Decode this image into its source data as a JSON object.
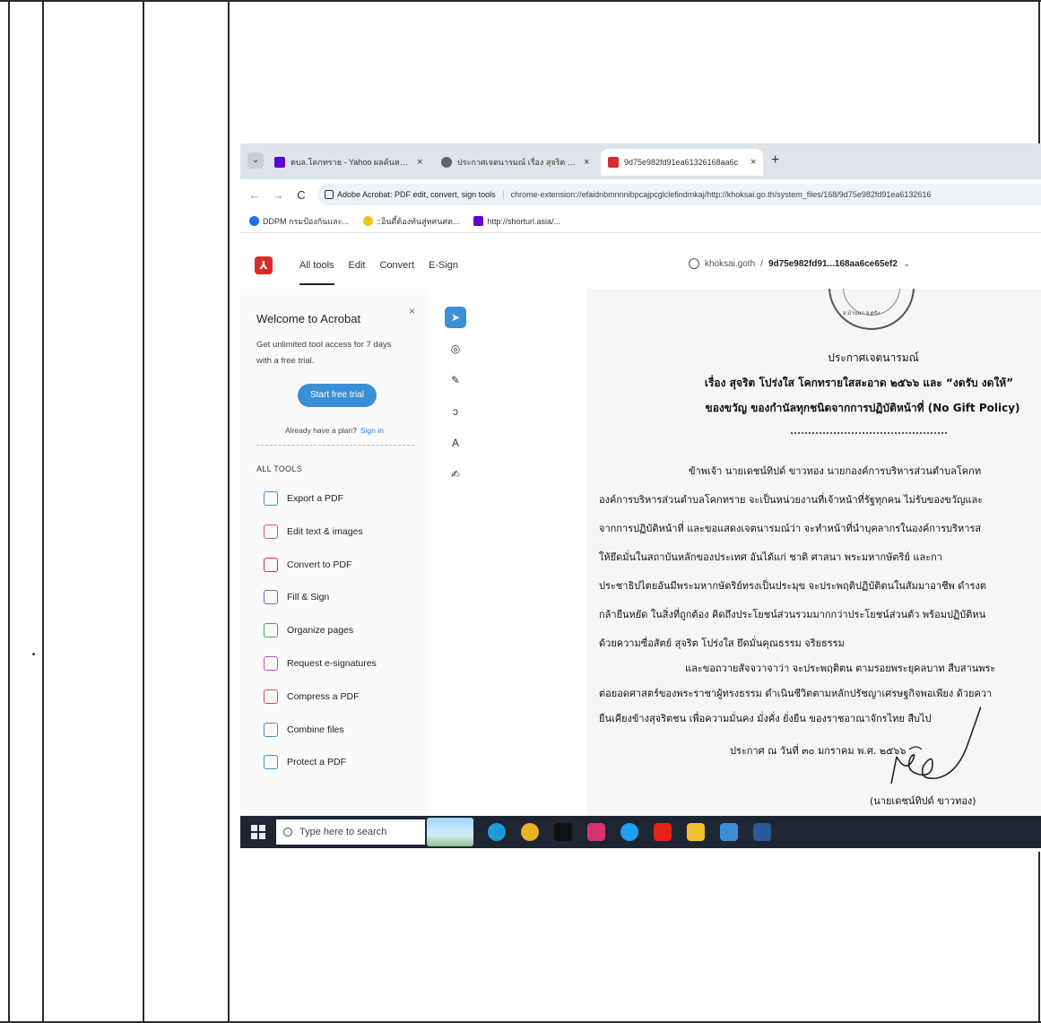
{
  "browser": {
    "tabs": [
      {
        "title": "ตบล.โคกทราย - Yahoo ผลค้นหาภา",
        "favicon_color": "#5f01d1",
        "active": false
      },
      {
        "title": "ประกาศเจตนารมณ์ เรื่อง สุจริต โปร่",
        "favicon_color": "#5f6368",
        "active": false
      },
      {
        "title": "9d75e982fd91ea61326168aa6c",
        "favicon_color": "#d92b2b",
        "active": true
      }
    ],
    "close_glyph": "×",
    "new_tab_glyph": "+",
    "tab_menu_glyph": "⌄",
    "nav": {
      "back": "←",
      "forward": "→",
      "reload": "C"
    },
    "site_label": "Adobe Acrobat: PDF edit, convert, sign tools",
    "url": "chrome-extension://efaidnbmnnnibpcajpcglclefindmkaj/http://khoksai.go.th/system_files/168/9d75e982fd91ea6132616",
    "bookmarks": [
      {
        "label": "DDPM กรมป้องกันและ...",
        "color": "#1a73e8"
      },
      {
        "label": "::อินดี้ต้องทันสู่ทศนศต...",
        "color": "#f0c419"
      },
      {
        "label": "http://shorturl.asia/...",
        "color": "#5f01d1"
      }
    ]
  },
  "acrobat": {
    "logo_glyph": "⅄",
    "nav": [
      "All tools",
      "Edit",
      "Convert",
      "E-Sign"
    ],
    "active_nav": "All tools",
    "file_host": "khoksai.goth",
    "file_sep": "/",
    "file_name": "9d75e982fd91...168aa6ce65ef2",
    "file_chevron": "⌄",
    "panel": {
      "close_glyph": "×",
      "title": "Welcome to Acrobat",
      "description": "Get unlimited tool access for 7 days with a free trial.",
      "trial_button": "Start free trial",
      "plan_text": "Already have a plan?",
      "sign_in": "Sign in",
      "all_tools_heading": "ALL TOOLS",
      "tools": [
        {
          "label": "Export a PDF",
          "icon": "export-pdf-icon",
          "color": "#3b8fd6"
        },
        {
          "label": "Edit text & images",
          "icon": "edit-text-icon",
          "color": "#d94a8c"
        },
        {
          "label": "Convert to PDF",
          "icon": "convert-pdf-icon",
          "color": "#d92b2b"
        },
        {
          "label": "Fill & Sign",
          "icon": "fill-sign-icon",
          "color": "#7a5cd6"
        },
        {
          "label": "Organize pages",
          "icon": "organize-pages-icon",
          "color": "#3aa655"
        },
        {
          "label": "Request e-signatures",
          "icon": "request-esign-icon",
          "color": "#b44fd1"
        },
        {
          "label": "Compress a PDF",
          "icon": "compress-pdf-icon",
          "color": "#d94a4a"
        },
        {
          "label": "Combine files",
          "icon": "combine-files-icon",
          "color": "#3b8fd6"
        },
        {
          "label": "Protect a PDF",
          "icon": "protect-pdf-icon",
          "color": "#3b8fd6"
        }
      ]
    },
    "vertical_tools": [
      {
        "name": "select-tool-icon",
        "glyph": "➤",
        "selected": true
      },
      {
        "name": "comment-tool-icon",
        "glyph": "◎",
        "selected": false
      },
      {
        "name": "pen-tool-icon",
        "glyph": "✎",
        "selected": false
      },
      {
        "name": "lasso-tool-icon",
        "glyph": "ↄ",
        "selected": false
      },
      {
        "name": "text-box-tool-icon",
        "glyph": "A",
        "selected": false
      },
      {
        "name": "signature-tool-icon",
        "glyph": "✍",
        "selected": false
      }
    ]
  },
  "document": {
    "seal_text": "อ.บ้านนา จ.ตรัง",
    "heading": "ประกาศเจตนารมณ์",
    "subject_line1": "เรื่อง สุจริต โปร่งใส โคกทรายใสสะอาด ๒๕๖๖ และ “งดรับ งดให้”",
    "subject_line2": "ของขวัญ ของกำนัลทุกชนิดจากการปฏิบัติหน้าที่ (No Gift Policy)",
    "paragraphs": [
      "ข้าพเจ้า นายเดชน์ทิปด์ ขาวทอง นายกองค์การบริหารส่วนตำบลโคกท",
      "องค์การบริหารส่วนตำบลโคกทราย จะเป็นหน่วยงานที่เจ้าหน้าที่รัฐทุกคน ไม่รับของขวัญและ",
      "จากการปฏิบัติหน้าที่ และขอแสดงเจตนารมณ์ว่า จะทำหน้าที่นำบุคลากรในองค์การบริหารส",
      "ให้ยึดมั่นในสถาบันหลักของประเทศ อันได้แก่ ชาติ ศาสนา พระมหากษัตริย์ และกา",
      "ประชาธิปไตยอันมีพระมหากษัตริย์ทรงเป็นประมุข จะประพฤติปฏิบัติตนในสัมมาอาชีพ ดำรงต",
      "กล้ายืนหยัด ในสิ่งที่ถูกต้อง คิดถึงประโยชน์ส่วนรวมมากกว่าประโยชน์ส่วนตัว พร้อมปฏิบัติหน",
      "ด้วยความซื่อสัตย์ สุจริต โปร่งใส ยึดมั่นคุณธรรม จริยธรรม",
      "และขอถวายสัจจวาจาว่า จะประพฤติตน ตามรอยพระยุคลบาท สืบสานพระ",
      "ต่อยอดศาสตร์ของพระราชาผู้ทรงธรรม ดำเนินชีวิตตามหลักปรัชญาเศรษฐกิจพอเพียง ด้วยควา",
      "ยืนเคียงข้างสุจริตชน เพื่อความมั่นคง มั่งคั่ง ยั่งยืน ของราชอาณาจักรไทย สืบไป"
    ],
    "date_line": "ประกาศ ณ วันที่ ๓๐ มกราคม พ.ศ. ๒๕๖๖",
    "signer": "(นายเดชน์ทิปด์ ขาวทอง)"
  },
  "taskbar": {
    "search_placeholder": "Type here to search",
    "apps": [
      {
        "name": "edge-icon",
        "color": "#1f9bd8"
      },
      {
        "name": "chrome-icon",
        "color": "#e9b224"
      },
      {
        "name": "tiktok-icon",
        "color": "#111111"
      },
      {
        "name": "instagram-icon",
        "color": "#d6336c"
      },
      {
        "name": "twitter-icon",
        "color": "#1da1f2"
      },
      {
        "name": "youtube-icon",
        "color": "#e62117"
      },
      {
        "name": "file-explorer-icon",
        "color": "#f2c230"
      },
      {
        "name": "settings-icon",
        "color": "#3b8fd6"
      },
      {
        "name": "word-icon",
        "color": "#2b5797"
      }
    ]
  }
}
